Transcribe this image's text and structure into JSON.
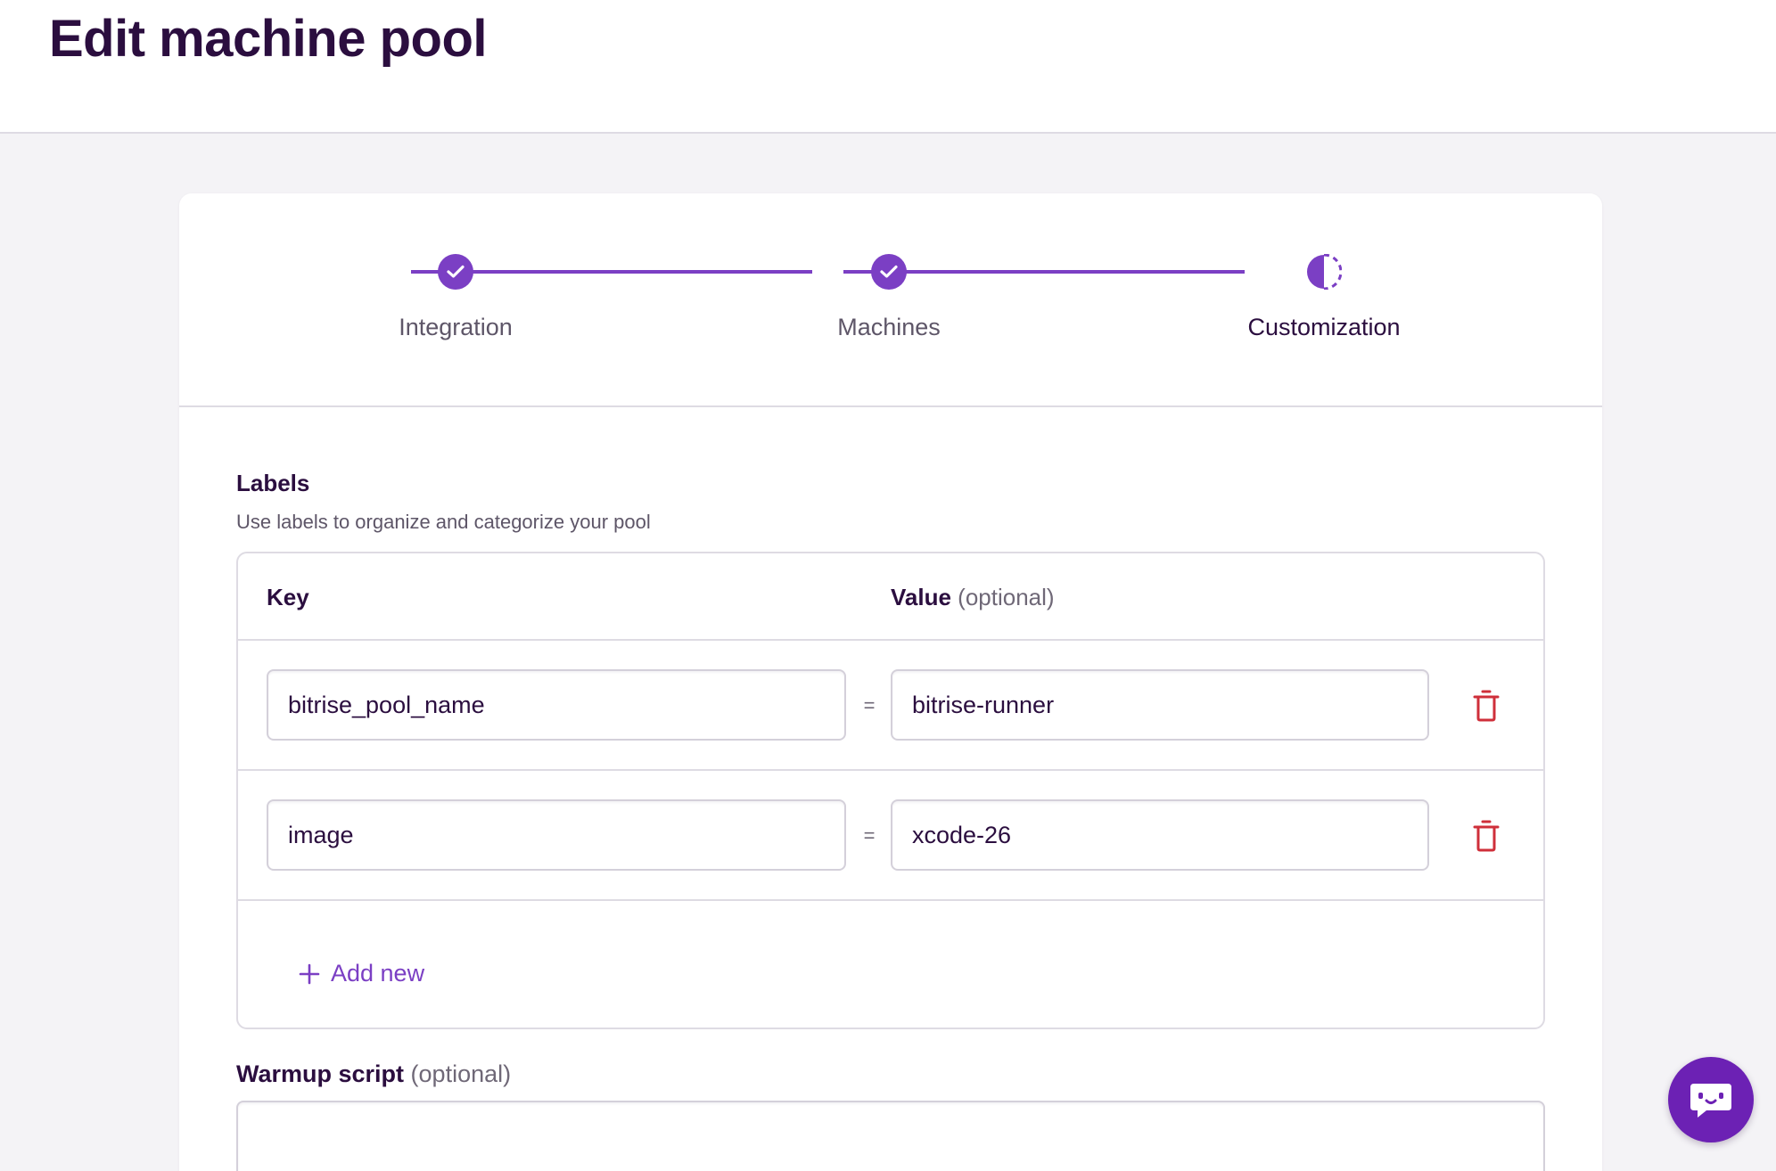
{
  "page": {
    "title": "Edit machine pool"
  },
  "stepper": {
    "steps": [
      {
        "label": "Integration",
        "state": "completed",
        "icon": "check-icon"
      },
      {
        "label": "Machines",
        "state": "completed",
        "icon": "check-icon"
      },
      {
        "label": "Customization",
        "state": "current",
        "icon": "half-circle-progress-icon"
      }
    ],
    "accent_color": "#7b3fc4"
  },
  "labels": {
    "title": "Labels",
    "description": "Use labels to organize and categorize your pool",
    "key_header": "Key",
    "value_header": "Value",
    "value_header_optional": "(optional)",
    "separator": "=",
    "rows": [
      {
        "key": "bitrise_pool_name",
        "value": "bitrise-runner",
        "delete_icon": "trash-icon"
      },
      {
        "key": "image",
        "value": "xcode-26",
        "delete_icon": "trash-icon"
      }
    ],
    "add_new_label": "Add new",
    "add_new_icon": "plus-icon"
  },
  "warmup": {
    "title": "Warmup script",
    "optional": "(optional)",
    "value": ""
  },
  "chat": {
    "icon": "chat-bot-icon",
    "color": "#6c21b4"
  },
  "colors": {
    "text_primary": "#2b0e3f",
    "text_secondary": "#5e5668",
    "danger": "#cf2f3a",
    "background": "#f4f3f6"
  }
}
